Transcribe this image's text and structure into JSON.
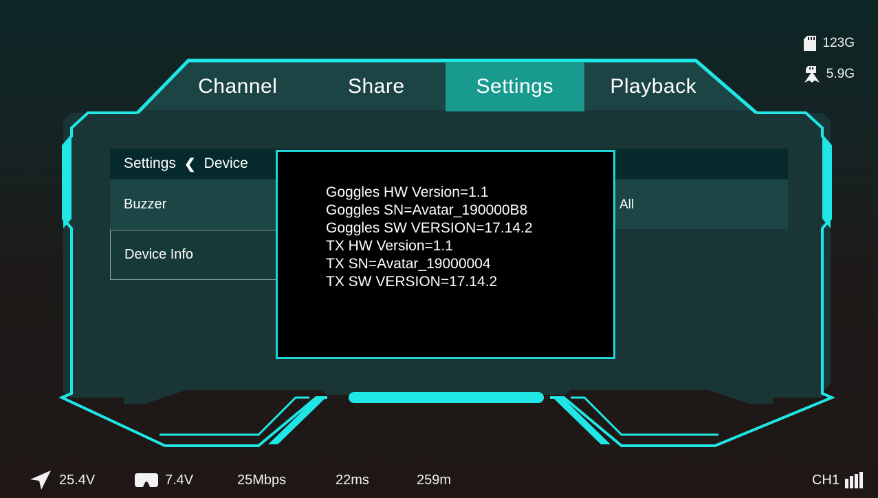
{
  "storage": {
    "sd_icon": "sd-card-icon",
    "sd_value": "123G",
    "internal_icon": "internal-storage-icon",
    "internal_value": "5.9G"
  },
  "tabs": [
    {
      "label": "Channel",
      "active": false
    },
    {
      "label": "Share",
      "active": false
    },
    {
      "label": "Settings",
      "active": true
    },
    {
      "label": "Playback",
      "active": false
    }
  ],
  "settings": {
    "breadcrumb_root": "Settings",
    "breadcrumb_current": "Device",
    "menu_items": [
      {
        "label": "Buzzer"
      },
      {
        "label": "Device Info"
      }
    ],
    "right_value": "All"
  },
  "dialog": {
    "lines": [
      "Goggles HW Version=1.1",
      "Goggles SN=Avatar_190000B8",
      "Goggles SW VERSION=17.14.2",
      "TX HW Version=1.1",
      "TX SN=Avatar_19000004",
      "TX SW VERSION=17.14.2"
    ]
  },
  "status": {
    "drone_voltage": "25.4V",
    "goggle_voltage": "7.4V",
    "bitrate": "25Mbps",
    "latency": "22ms",
    "distance": "259m",
    "channel": "CH1"
  },
  "colors": {
    "accent_cyan": "#20e6e6",
    "active_tab": "#189a8f",
    "panel_dark": "#062a2b",
    "panel_row": "#1b4645"
  }
}
